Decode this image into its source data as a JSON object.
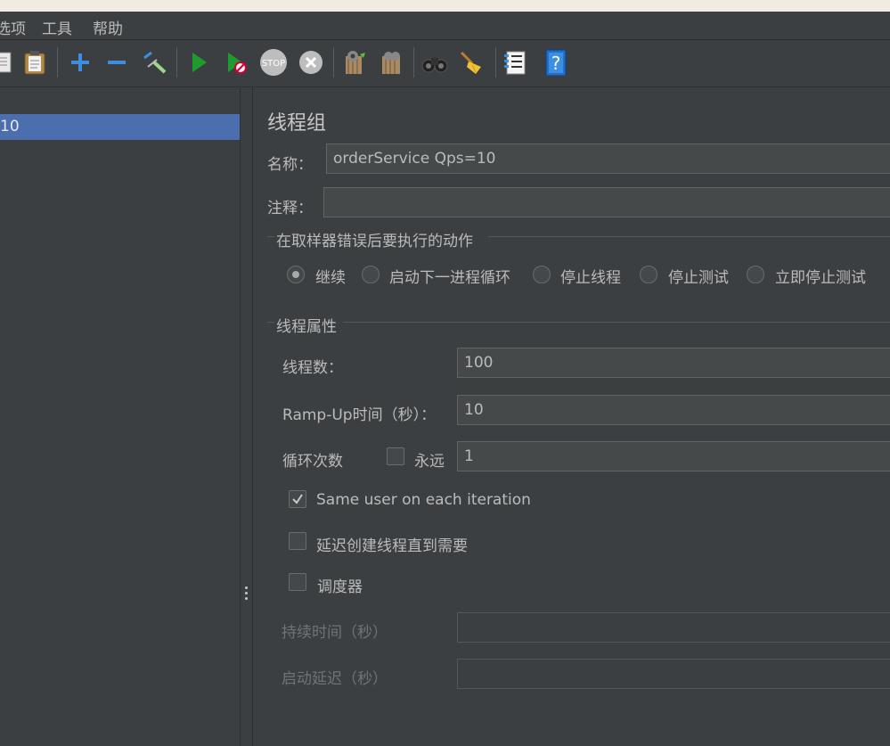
{
  "menubar": {
    "items": [
      "选项",
      "工具",
      "帮助"
    ]
  },
  "toolbar": {
    "icons": [
      "copy-icon",
      "paste-icon",
      "expand-icon",
      "collapse-icon",
      "toggle-icon",
      "start-icon",
      "start-no-pauses-icon",
      "stop-icon",
      "shutdown-icon",
      "clear-icon",
      "clear-all-icon",
      "search-icon",
      "reset-search-icon",
      "function-helper-icon",
      "help-icon"
    ]
  },
  "tree": {
    "selected_item": "10"
  },
  "panel": {
    "title": "线程组",
    "name_label": "名称：",
    "name_value": "orderService Qps=10",
    "comment_label": "注释：",
    "comment_value": "",
    "error_section": {
      "legend": "在取样器错误后要执行的动作",
      "options": [
        "继续",
        "启动下一进程循环",
        "停止线程",
        "停止测试",
        "立即停止测试"
      ],
      "selected": "继续"
    },
    "thread_props": {
      "legend": "线程属性",
      "threads_label": "线程数：",
      "threads_value": "100",
      "rampup_label": "Ramp-Up时间（秒）：",
      "rampup_value": "10",
      "loop_label": "循环次数",
      "forever_label": "永远",
      "forever_checked": false,
      "loop_value": "1",
      "same_user_label": "Same user on each iteration",
      "same_user_checked": true,
      "delay_label": "延迟创建线程直到需要",
      "delay_checked": false,
      "scheduler_label": "调度器",
      "scheduler_checked": false,
      "duration_label": "持续时间（秒）",
      "duration_value": "",
      "startup_delay_label": "启动延迟（秒）",
      "startup_delay_value": ""
    }
  }
}
